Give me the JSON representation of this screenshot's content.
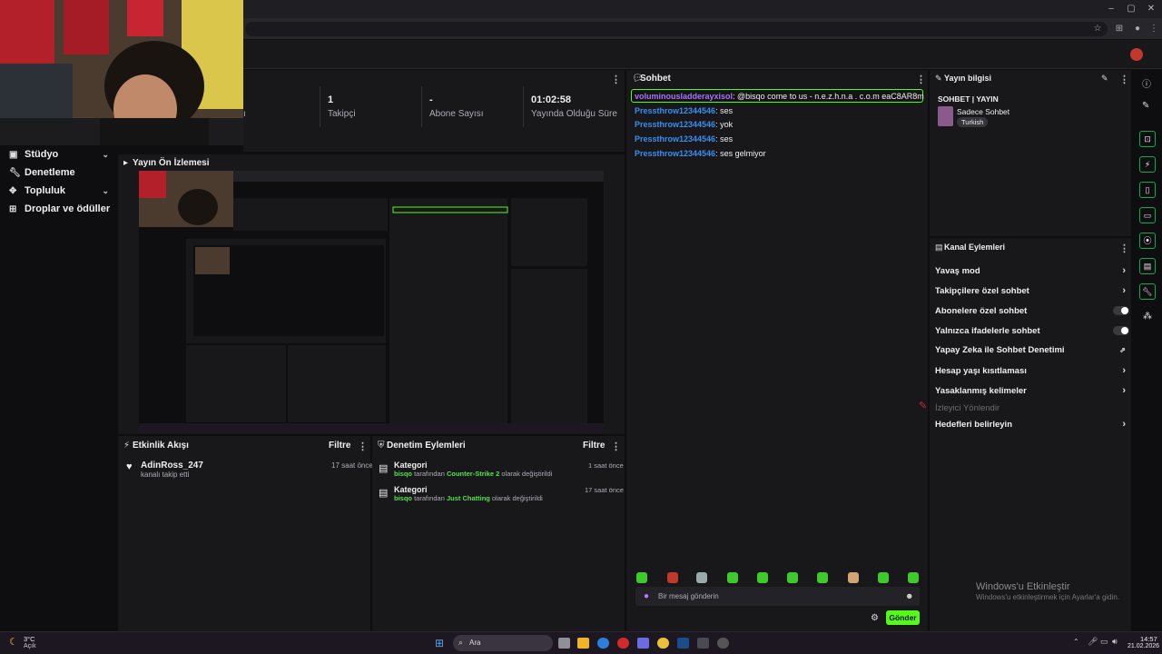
{
  "sidebar": {
    "items": [
      {
        "label": "Stüdyo",
        "icon": "studio-icon"
      },
      {
        "label": "Denetleme",
        "icon": "wrench-icon"
      },
      {
        "label": "Topluluk",
        "icon": "community-icon"
      },
      {
        "label": "Droplar ve ödüller",
        "icon": "gift-icon"
      }
    ]
  },
  "stats": {
    "partial_label": "ı",
    "followers": {
      "value": "1",
      "label": "Takipçi"
    },
    "subscribers": {
      "value": "-",
      "label": "Abone Sayısı"
    },
    "uptime": {
      "value": "01:02:58",
      "label": "Yayında Olduğu Süre"
    }
  },
  "preview": {
    "title": "Yayın Ön İzlemesi"
  },
  "activity": {
    "title": "Etkinlik Akışı",
    "filter": "Filtre",
    "items": [
      {
        "user": "AdinRoss_247",
        "text": "kanalı takip etti",
        "time": "17 saat önce"
      }
    ]
  },
  "moderation": {
    "title": "Denetim Eylemleri",
    "filter": "Filtre",
    "items": [
      {
        "title": "Kategori",
        "mod": "bisqo",
        "pre": "tarafından",
        "game": "Counter-Strike 2",
        "post": "olarak değiştirildi",
        "time": "1 saat önce"
      },
      {
        "title": "Kategori",
        "mod": "bisqo",
        "pre": "tarafından",
        "game": "Just Chatting",
        "post": "olarak değiştirildi",
        "time": "17 saat önce"
      }
    ]
  },
  "chat": {
    "title": "Sohbet",
    "pinned": {
      "user": "voluminousladderayxisol",
      "text": ": @bisqo come to us - n.e.z.h.n.a . c.o.m eaC8AR8m"
    },
    "messages": [
      {
        "user": "Pressthrow12344546",
        "text": ": ses"
      },
      {
        "user": "Pressthrow12344546",
        "text": ": yok"
      },
      {
        "user": "Pressthrow12344546",
        "text": ": ses"
      },
      {
        "user": "Pressthrow12344546",
        "text": ": ses gelmiyor"
      }
    ],
    "input_placeholder": "Bir mesaj gönderin",
    "send": "Gönder"
  },
  "stream_info": {
    "title": "Yayın bilgisi",
    "stream_title": "SOHBET | YAYIN",
    "category": "Sadece Sohbet",
    "tag": "Turkish"
  },
  "channel_actions": {
    "title": "Kanal Eylemleri",
    "items": [
      {
        "label": "Yavaş mod",
        "control": "chevron"
      },
      {
        "label": "Takipçilere özel sohbet",
        "control": "chevron"
      },
      {
        "label": "Abonelere özel sohbet",
        "control": "toggle",
        "on": false
      },
      {
        "label": "Yalnızca ifadelerle sohbet",
        "control": "toggle",
        "on": false
      },
      {
        "label": "Yapay Zeka ile Sohbet Denetimi",
        "control": "external"
      },
      {
        "label": "Hesap yaşı kısıtlaması",
        "control": "chevron"
      },
      {
        "label": "Yasaklanmış kelimeler",
        "control": "chevron"
      },
      {
        "label": "İzleyici Yönlendir",
        "control": "none"
      },
      {
        "label": "Hedefleri belirleyin",
        "control": "chevron"
      }
    ]
  },
  "watermark": {
    "title": "Windows'u Etkinleştir",
    "subtitle": "Windows'u etkinleştirmek için Ayarlar'a gidin."
  },
  "taskbar": {
    "weather_temp": "3°C",
    "weather_desc": "Açık",
    "search": "Ara",
    "time": "14:57",
    "date": "21.02.2026"
  },
  "colors": {
    "accent_green": "#53fc18",
    "chat_user_blue": "#3a8ef0",
    "chat_user_purple": "#a970ff"
  }
}
